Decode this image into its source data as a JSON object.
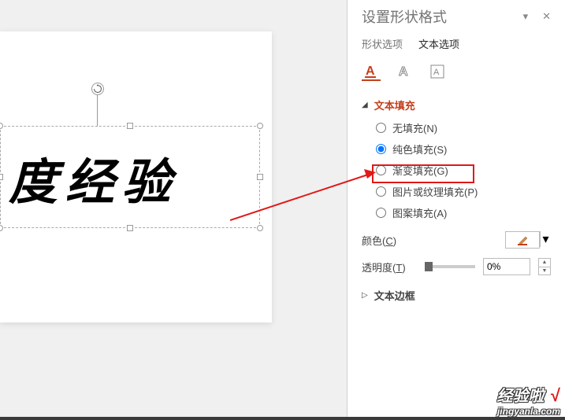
{
  "slide": {
    "text": "度经验"
  },
  "panel": {
    "title": "设置形状格式",
    "tabs": {
      "shape": "形状选项",
      "text": "文本选项"
    },
    "sections": {
      "text_fill": "文本填充",
      "text_outline": "文本边框"
    },
    "fill_options": {
      "none": "无填充(N)",
      "solid": "纯色填充(S)",
      "gradient": "渐变填充(G)",
      "picture": "图片或纹理填充(P)",
      "pattern": "图案填充(A)"
    },
    "props": {
      "color_label": "颜色",
      "color_hotkey": "C",
      "opacity_label": "透明度",
      "opacity_hotkey": "T",
      "opacity_value": "0%"
    }
  },
  "watermark": {
    "line1": "经验啦",
    "check": "√",
    "line2": "jingyanla.com"
  }
}
